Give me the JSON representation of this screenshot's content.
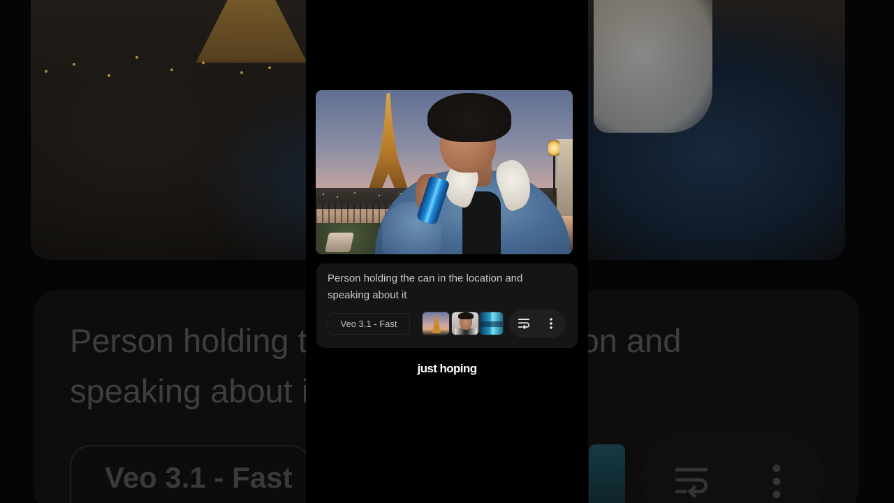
{
  "background": {
    "prompt_text": "Person holding the can in the location and speaking about it",
    "model_label": "Veo 3.1 - Fast"
  },
  "card": {
    "prompt_text": "Person holding the can in the location and speaking about it",
    "model_label": "Veo 3.1 - Fast",
    "reference_thumbnails": [
      {
        "name": "eiffel-tower-thumbnail"
      },
      {
        "name": "person-thumbnail"
      },
      {
        "name": "can-thumbnail"
      }
    ],
    "actions": [
      {
        "name": "wrap-text-icon"
      },
      {
        "name": "more-options-icon"
      }
    ]
  },
  "caption": "just hoping",
  "colors": {
    "page_bg": "#000000",
    "card_bg": "#151515",
    "actions_bg": "#1f1f1f",
    "prompt_text": "#c9c9c9",
    "caption_text": "#ffffff"
  }
}
